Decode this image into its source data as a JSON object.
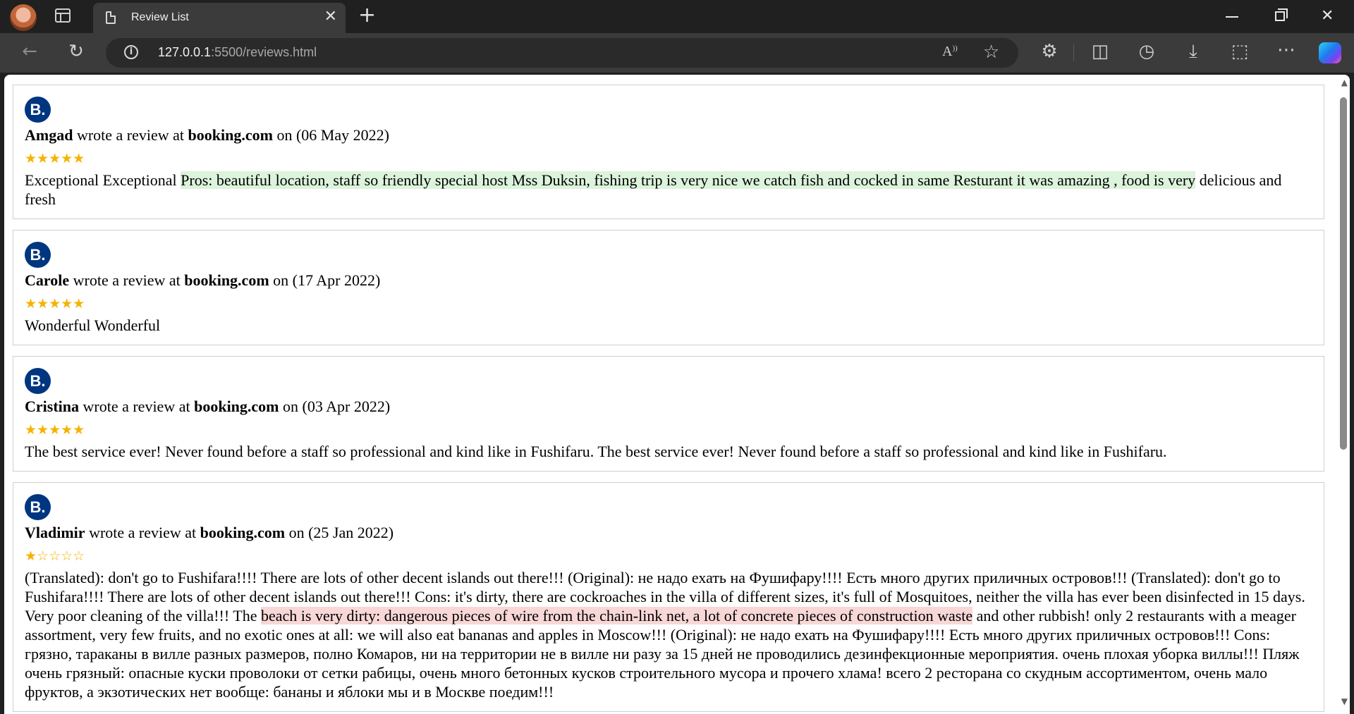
{
  "browser": {
    "tab_title": "Review List",
    "tab_close": "✕",
    "new_tab": "+",
    "url_host": "127.0.0.1",
    "url_path": ":5500/reviews.html",
    "read_aloud": "A⁾"
  },
  "reviews": [
    {
      "logo": "B.",
      "author": "Amgad",
      "mid": " wrote a review at ",
      "site": "booking.com",
      "date": " on (06 May 2022)",
      "stars": "★★★★★",
      "text_plain": "Exceptional Exceptional ",
      "text_highlight": "Pros: beautiful location, staff so friendly special host Mss Duksin, fishing trip is very nice we catch fish and cocked in same Resturant it was amazing , food is very",
      "text_after": " delicious and fresh"
    },
    {
      "logo": "B.",
      "author": "Carole",
      "mid": " wrote a review at ",
      "site": "booking.com",
      "date": " on (17 Apr 2022)",
      "stars": "★★★★★",
      "text": "Wonderful Wonderful"
    },
    {
      "logo": "B.",
      "author": "Cristina",
      "mid": " wrote a review at ",
      "site": "booking.com",
      "date": " on (03 Apr 2022)",
      "stars": "★★★★★",
      "text": "The best service ever! Never found before a staff so professional and kind like in Fushifaru. The best service ever! Never found before a staff so professional and kind like in Fushifaru."
    },
    {
      "logo": "B.",
      "author": "Vladimir",
      "mid": " wrote a review at ",
      "site": "booking.com",
      "date": " on (25 Jan 2022)",
      "stars": "★☆☆☆☆",
      "text_before": "(Translated): don't go to Fushifara!!!! There are lots of other decent islands out there!!! (Original): не надо ехать на Фушифару!!!! Есть много других приличных островов!!! (Translated): don't go to Fushifara!!!! There are lots of other decent islands out there!!! Cons: it's dirty, there are cockroaches in the villa of different sizes, it's full of Mosquitoes, neither the villa has ever been disinfected in 15 days. Very poor cleaning of the villa!!! The ",
      "text_highlight": "beach is very dirty: dangerous pieces of wire from the chain-link net, a lot of concrete pieces of construction waste",
      "text_after": " and other rubbish! only 2 restaurants with a meager assortment, very few fruits, and no exotic ones at all: we will also eat bananas and apples in Moscow!!! (Original): не надо ехать на Фушифару!!!! Есть много других приличных островов!!! Cons: грязно, тараканы в вилле разных размеров, полно Комаров, ни на территории не в вилле ни разу за 15 дней не проводились дезинфекционные мероприятия. очень плохая уборка виллы!!! Пляж очень грязный: опасные куски проволоки от сетки рабицы, очень много бетонных кусков строительного мусора и прочего хлама! всего 2 ресторана со скудным ассортиментом, очень мало фруктов, а экзотических нет вообще: бананы и яблоки мы и в Москве поедим!!!"
    }
  ],
  "colors": {
    "star": "#f5b300",
    "booking_blue": "#003580",
    "positive_highlight": "#dcf3dc",
    "negative_highlight": "#f8d7d7"
  }
}
